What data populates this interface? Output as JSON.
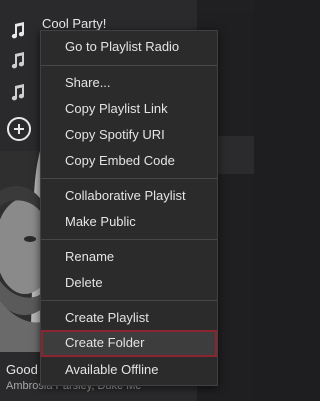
{
  "sidebar": {
    "playlists": [
      {
        "label": "Cool Party!",
        "icon": "music-note-icon"
      },
      {
        "label": "",
        "icon": "music-note-icon"
      },
      {
        "label": "",
        "icon": "music-note-icon"
      }
    ],
    "new_playlist_icon": "plus-circle-icon"
  },
  "now_playing": {
    "title": "Good",
    "artist": "Ambrosia Parsley, Duke Mc"
  },
  "context_menu": {
    "items": [
      {
        "label": "Go to Playlist Radio"
      },
      {
        "label": "Share..."
      },
      {
        "label": "Copy Playlist Link"
      },
      {
        "label": "Copy Spotify URI"
      },
      {
        "label": "Copy Embed Code"
      },
      {
        "label": "Collaborative Playlist"
      },
      {
        "label": "Make Public"
      },
      {
        "label": "Rename"
      },
      {
        "label": "Delete"
      },
      {
        "label": "Create Playlist"
      },
      {
        "label": "Create Folder",
        "highlighted": true,
        "highlight_color": "#8b2530"
      },
      {
        "label": "Available Offline"
      }
    ]
  },
  "colors": {
    "sidebar_bg": "#2a2a2c",
    "menu_bg": "#2b2b2b",
    "text": "#e4e4e4",
    "highlight_border": "#8b2530"
  }
}
